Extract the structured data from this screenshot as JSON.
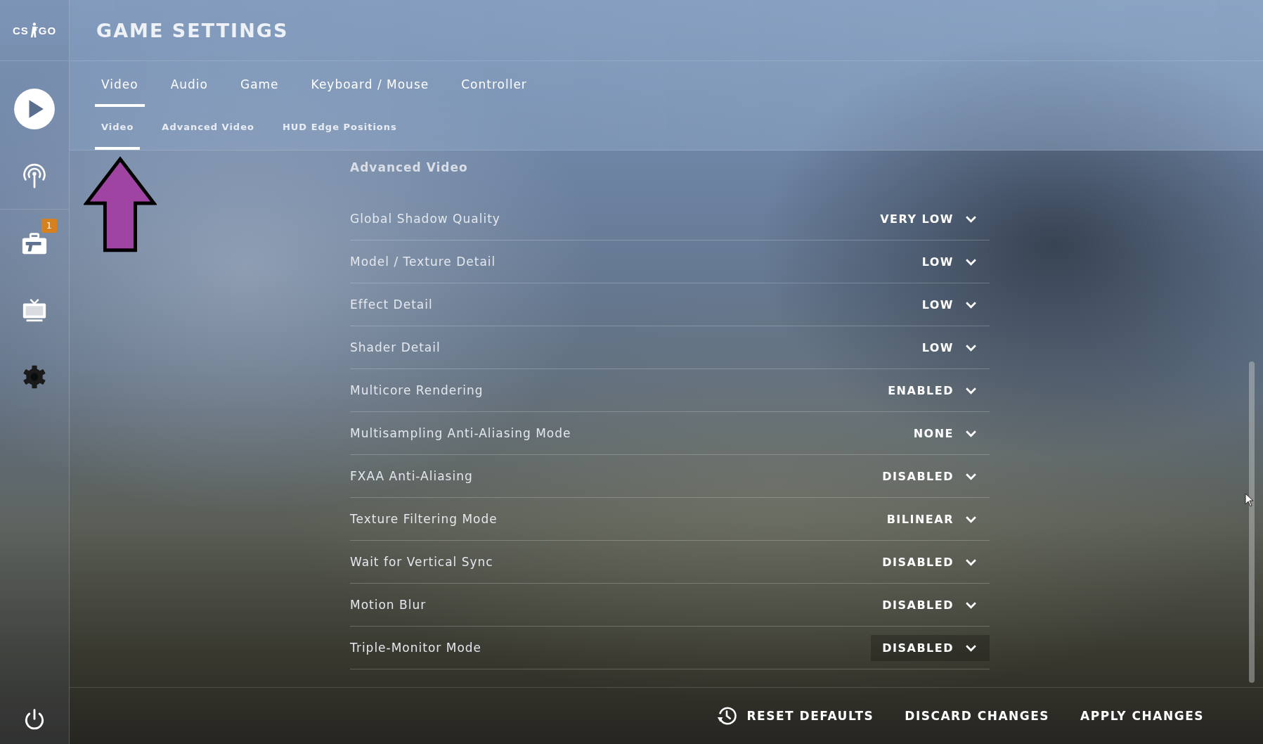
{
  "sidebar": {
    "logo": {
      "left": "CS",
      "right": "GO"
    },
    "items": [
      {
        "kind": "play",
        "selected": false
      },
      {
        "kind": "broadcast",
        "selected": false
      },
      {
        "kind": "inventory",
        "selected": false,
        "badge": "1"
      },
      {
        "kind": "tv",
        "selected": false
      },
      {
        "kind": "settings",
        "selected": true
      }
    ],
    "footer": {
      "kind": "power"
    }
  },
  "header": {
    "title": "GAME SETTINGS"
  },
  "tabs": [
    {
      "label": "Video",
      "selected": true
    },
    {
      "label": "Audio",
      "selected": false
    },
    {
      "label": "Game",
      "selected": false
    },
    {
      "label": "Keyboard / Mouse",
      "selected": false
    },
    {
      "label": "Controller",
      "selected": false
    }
  ],
  "subtabs": [
    {
      "label": "Video",
      "selected": true
    },
    {
      "label": "Advanced Video",
      "selected": false
    },
    {
      "label": "HUD Edge Positions",
      "selected": false
    }
  ],
  "section": {
    "title": "Advanced Video",
    "rows": [
      {
        "label": "Global Shadow Quality",
        "value": "VERY LOW",
        "highlighted": false
      },
      {
        "label": "Model / Texture Detail",
        "value": "LOW",
        "highlighted": false
      },
      {
        "label": "Effect Detail",
        "value": "LOW",
        "highlighted": false
      },
      {
        "label": "Shader Detail",
        "value": "LOW",
        "highlighted": false
      },
      {
        "label": "Multicore Rendering",
        "value": "ENABLED",
        "highlighted": false
      },
      {
        "label": "Multisampling Anti-Aliasing Mode",
        "value": "NONE",
        "highlighted": false
      },
      {
        "label": "FXAA Anti-Aliasing",
        "value": "DISABLED",
        "highlighted": false
      },
      {
        "label": "Texture Filtering Mode",
        "value": "BILINEAR",
        "highlighted": false
      },
      {
        "label": "Wait for Vertical Sync",
        "value": "DISABLED",
        "highlighted": false
      },
      {
        "label": "Motion Blur",
        "value": "DISABLED",
        "highlighted": false
      },
      {
        "label": "Triple-Monitor Mode",
        "value": "DISABLED",
        "highlighted": true
      }
    ]
  },
  "footer_buttons": [
    {
      "kind": "reset",
      "label": "RESET DEFAULTS"
    },
    {
      "kind": "plain",
      "label": "DISCARD CHANGES"
    },
    {
      "kind": "plain",
      "label": "APPLY CHANGES"
    }
  ]
}
